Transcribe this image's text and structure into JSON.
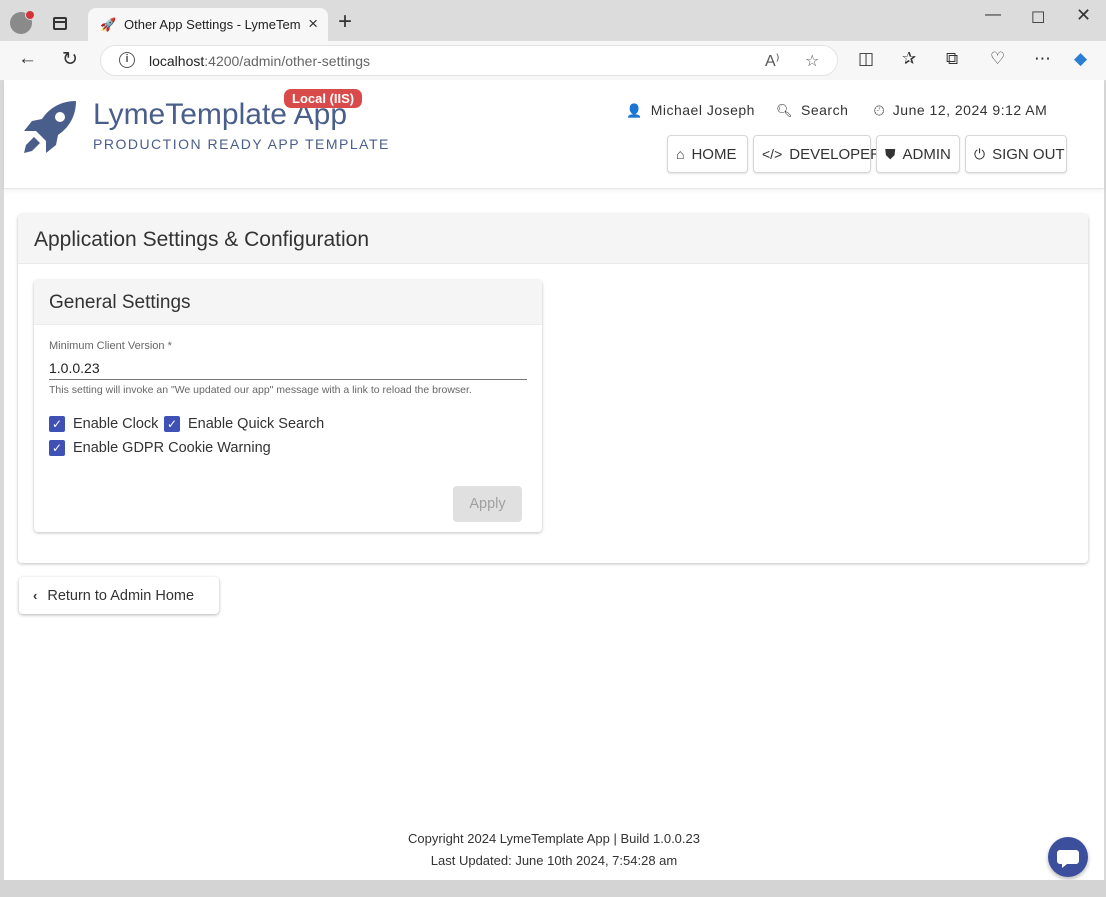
{
  "browser": {
    "tab_title": "Other App Settings - LymeTempl",
    "url_host": "localhost",
    "url_path": ":4200/admin/other-settings"
  },
  "header": {
    "app_name": "LymeTemplate App",
    "env_badge": "Local (IIS)",
    "tagline": "PRODUCTION READY APP TEMPLATE",
    "user_name": "Michael Joseph",
    "search_label": "Search",
    "clock": "June 12, 2024 9:12 AM",
    "nav": {
      "home": "HOME",
      "developer": "DEVELOPER",
      "admin": "ADMIN",
      "signout": "SIGN OUT"
    }
  },
  "main": {
    "card_title": "Application Settings & Configuration",
    "general": {
      "title": "General Settings",
      "min_version_label": "Minimum Client Version *",
      "min_version_value": "1.0.0.23",
      "min_version_hint": "This setting will invoke an \"We updated our app\" message with a link to reload the browser.",
      "enable_clock": "Enable Clock",
      "enable_quick_search": "Enable Quick Search",
      "enable_gdpr": "Enable GDPR Cookie Warning",
      "apply": "Apply"
    },
    "return_label": "Return to Admin Home"
  },
  "footer": {
    "line1": "Copyright 2024 LymeTemplate App | Build 1.0.0.23",
    "line2": "Last Updated: June 10th 2024, 7:54:28 am"
  },
  "colors": {
    "brand": "#4a5e8c",
    "badge": "#d94b4b",
    "checkbox": "#3f51b5"
  }
}
